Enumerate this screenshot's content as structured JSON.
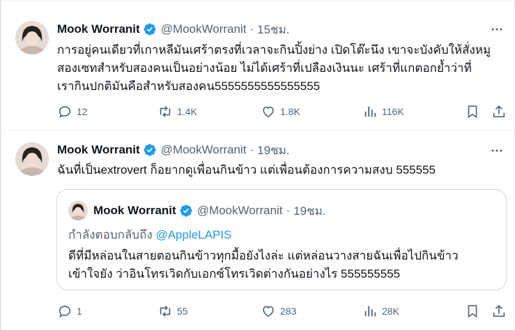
{
  "posts": [
    {
      "author": "Mook Worranit",
      "handle": "@MookWorranit",
      "separator": "·",
      "time": "15ชม.",
      "lines": [
        "การอยู่คนเดียวที่เกาหลีมันเศร้าตรงที่เวลาจะกินปิ้งย่าง เปิดโต๊ะนึง เขาจะบังคับให้สั่งหมู",
        "สองเซทสำหรับสองคนเป็นอย่างน้อย ไม่ได้เศร้าที่เปลืองเงินนะ เศร้าที่แกตอกย้ำว่าที่",
        "เรากินปกติมันคือสำหรับสองคน5555555555555555"
      ],
      "stats": {
        "replies": "12",
        "reposts": "1.4K",
        "likes": "1.8K",
        "views": "116K"
      }
    },
    {
      "author": "Mook Worranit",
      "handle": "@MookWorranit",
      "separator": "·",
      "time": "19ชม.",
      "lines": [
        "ฉันที่เป็นextrovert ก็อยากดูเพื่อนกินข้าว แต่เพื่อนต้องการความสงบ 555555"
      ],
      "stats": {
        "replies": "1",
        "reposts": "55",
        "likes": "283",
        "views": "28K"
      }
    }
  ],
  "quote": {
    "author": "Mook Worranit",
    "handle": "@MookWorranit",
    "separator": "·",
    "time": "19ชม.",
    "reply_prefix": "กำลังตอบกลับถึง",
    "reply_to": "@AppleLAPIS",
    "lines": [
      "ดีที่มีหล่อนในสายตอนกินข้าวทุกมื้อยังไงล่ะ แต่หล่อนวางสายฉันเพื่อไปกินข้าว",
      "เข้าใจยัง ว่าอินโทรเวิดกับเอกซ์โทรเวิดต่างกันอย่างไร 555555555"
    ]
  },
  "colors": {
    "text": "#0f1419",
    "secondary": "#536471",
    "verified": "#1d9bf0",
    "link": "#1d9bf0",
    "border": "#cfd9de"
  },
  "icons": [
    "verified-badge-icon",
    "more-icon",
    "reply-icon",
    "repost-icon",
    "like-icon",
    "views-icon",
    "bookmark-icon",
    "share-icon"
  ]
}
